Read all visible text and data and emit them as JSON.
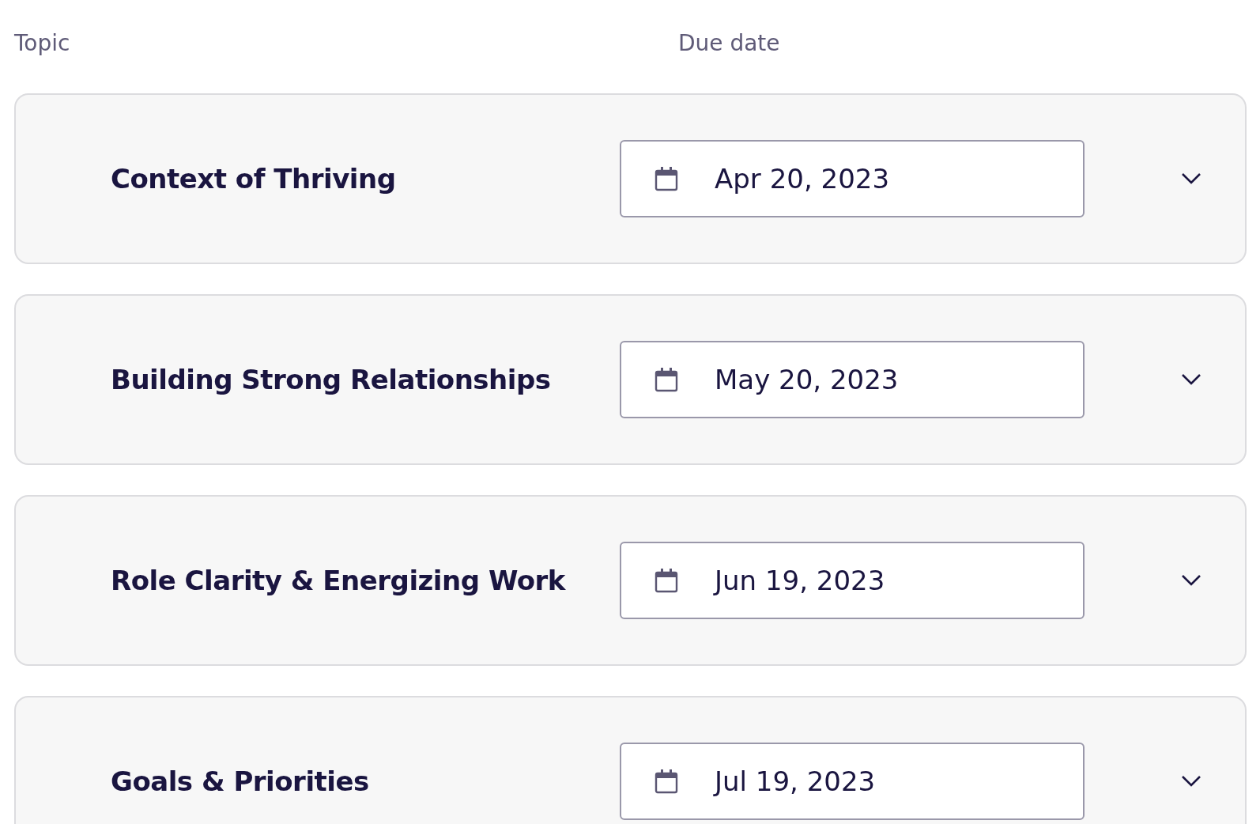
{
  "columns": [
    {
      "label": "Topic"
    },
    {
      "label": "Due date"
    }
  ],
  "topics": [
    {
      "title": "Context of Thriving",
      "due_date": "Apr 20, 2023",
      "expanded": false
    },
    {
      "title": "Building Strong Relationships",
      "due_date": "May 20, 2023",
      "expanded": false
    },
    {
      "title": "Role Clarity & Energizing Work",
      "due_date": "Jun 19, 2023",
      "expanded": false
    },
    {
      "title": "Goals & Priorities",
      "due_date": "Jul 19, 2023",
      "expanded": false
    }
  ]
}
